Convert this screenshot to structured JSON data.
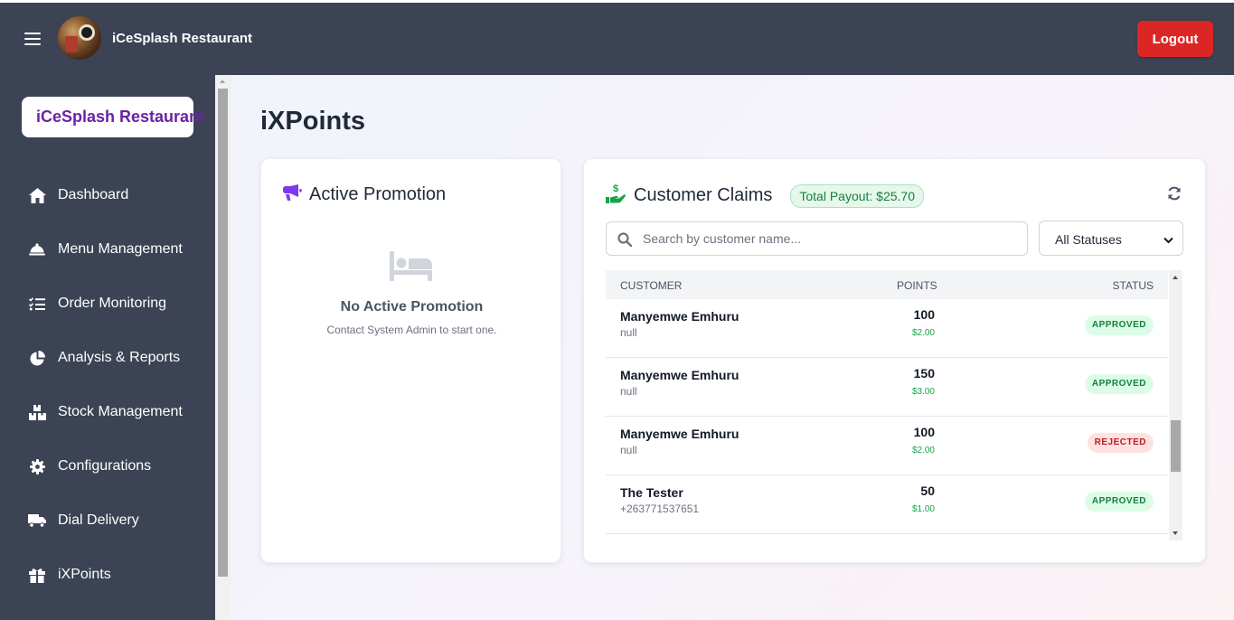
{
  "header": {
    "brand": "iCeSplash Restaurant",
    "logout_label": "Logout"
  },
  "sidebar": {
    "brand": "iCeSplash Restaurant",
    "items": [
      {
        "label": "Dashboard",
        "icon": "home-icon"
      },
      {
        "label": "Menu Management",
        "icon": "cloche-icon"
      },
      {
        "label": "Order Monitoring",
        "icon": "list-check-icon"
      },
      {
        "label": "Analysis & Reports",
        "icon": "pie-chart-icon"
      },
      {
        "label": "Stock Management",
        "icon": "boxes-icon"
      },
      {
        "label": "Configurations",
        "icon": "gear-icon"
      },
      {
        "label": "Dial Delivery",
        "icon": "truck-icon"
      },
      {
        "label": "iXPoints",
        "icon": "gift-icon"
      }
    ]
  },
  "page": {
    "title": "iXPoints"
  },
  "promotion": {
    "title": "Active Promotion",
    "empty_title": "No Active Promotion",
    "empty_subtitle": "Contact System Admin to start one."
  },
  "claims": {
    "title": "Customer Claims",
    "total_payout": "Total Payout: $25.70",
    "search_placeholder": "Search by customer name...",
    "status_filter": "All Statuses",
    "columns": {
      "customer": "CUSTOMER",
      "points": "POINTS",
      "status": "STATUS"
    },
    "rows": [
      {
        "name": "Manyemwe Emhuru",
        "phone": "null",
        "points": "100",
        "amount": "$2.00",
        "status": "APPROVED"
      },
      {
        "name": "Manyemwe Emhuru",
        "phone": "null",
        "points": "150",
        "amount": "$3.00",
        "status": "APPROVED"
      },
      {
        "name": "Manyemwe Emhuru",
        "phone": "null",
        "points": "100",
        "amount": "$2.00",
        "status": "REJECTED"
      },
      {
        "name": "The Tester",
        "phone": "+263771537651",
        "points": "50",
        "amount": "$1.00",
        "status": "APPROVED"
      }
    ]
  },
  "colors": {
    "header_bg": "#3b4354",
    "logout_bg": "#dc2626",
    "brand_purple": "#6b21a8",
    "accent_purple": "#7c3aed",
    "money_green": "#16a34a"
  }
}
